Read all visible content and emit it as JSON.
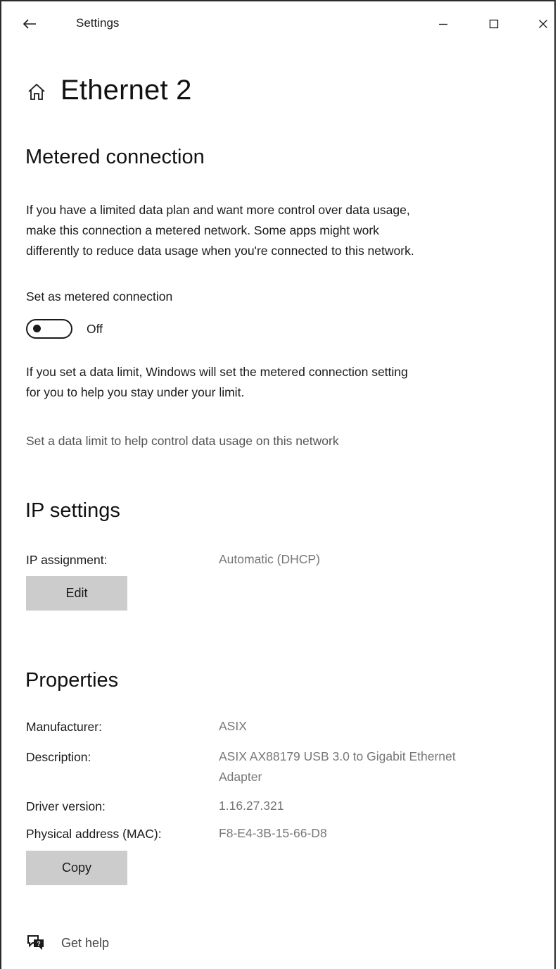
{
  "window": {
    "title": "Settings"
  },
  "page": {
    "title": "Ethernet 2"
  },
  "metered": {
    "heading": "Metered connection",
    "description_lines": [
      "If you have a limited data plan and want more control over data usage,",
      "make this connection a metered network. Some apps might work",
      "differently to reduce data usage when you're connected to this network."
    ],
    "toggle_label": "Set as metered connection",
    "toggle_state": "Off",
    "limit_lines": [
      "If you set a data limit, Windows will set the metered connection setting",
      "for you to help you stay under your limit."
    ],
    "limit_link": "Set a data limit to help control data usage on this network"
  },
  "ip": {
    "heading": "IP settings",
    "assignment_label": "IP assignment:",
    "assignment_value": "Automatic (DHCP)",
    "edit_label": "Edit"
  },
  "properties": {
    "heading": "Properties",
    "rows": [
      {
        "label": "Manufacturer:",
        "value_lines": [
          "ASIX"
        ]
      },
      {
        "label": "Description:",
        "value_lines": [
          "ASIX AX88179 USB 3.0 to Gigabit Ethernet",
          "Adapter"
        ]
      },
      {
        "label": "Driver version:",
        "value_lines": [
          "1.16.27.321"
        ]
      },
      {
        "label": "Physical address (MAC):",
        "value_lines": [
          "F8-E4-3B-15-66-D8"
        ]
      }
    ],
    "copy_label": "Copy"
  },
  "help": {
    "label": "Get help"
  },
  "icons": {
    "back": "back-arrow-icon",
    "minimize": "minimize-icon",
    "maximize": "maximize-icon",
    "close": "close-icon",
    "home": "home-icon",
    "help": "chat-help-icon"
  }
}
